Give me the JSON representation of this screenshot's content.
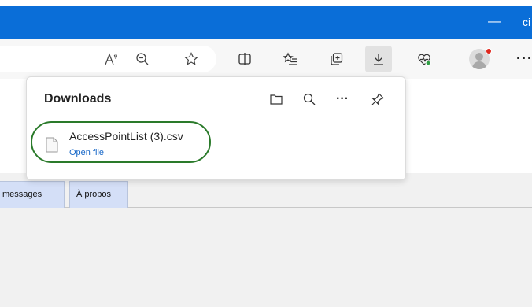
{
  "window": {
    "minimize_glyph": "—",
    "restore_glyph": "ci"
  },
  "toolbar": {
    "more_glyph": "···",
    "icons": [
      "read-aloud-icon",
      "zoom-out-icon",
      "favorite-star-icon",
      "split-screen-icon",
      "favorites-list-icon",
      "collections-icon",
      "download-icon",
      "browser-essentials-icon",
      "profile-icon",
      "more-icon"
    ]
  },
  "downloads": {
    "title": "Downloads",
    "icons": [
      "open-folder-icon",
      "search-icon",
      "more-options-icon",
      "pin-icon"
    ],
    "more_glyph": "···",
    "items": [
      {
        "filename": "AccessPointList (3).csv",
        "action": "Open file"
      }
    ]
  },
  "page": {
    "tabs": [
      {
        "label": "messages"
      },
      {
        "label": "À propos"
      }
    ]
  },
  "colors": {
    "title_bar": "#0a6ed8",
    "link": "#1566c7",
    "highlight": "#2a7a2a",
    "tab_bg": "#d4dff7",
    "notification": "#e0281e"
  }
}
